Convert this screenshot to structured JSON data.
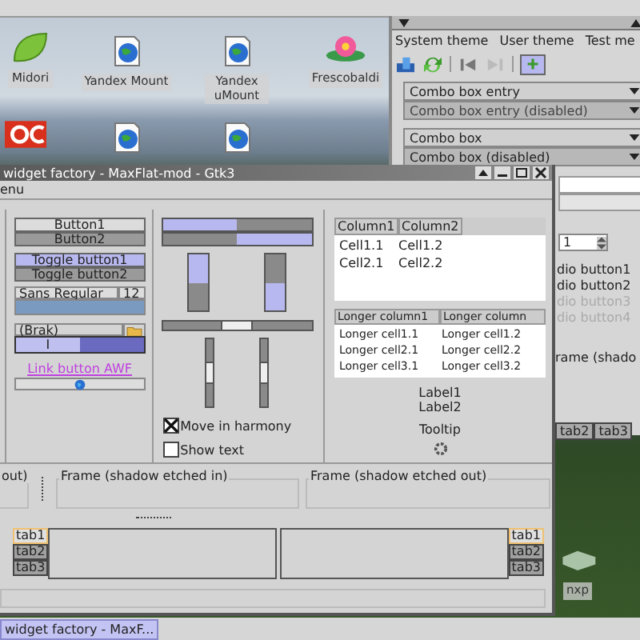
{
  "desktop_icons": [
    {
      "label": "Midori",
      "kind": "leaf"
    },
    {
      "label": "Yandex Mount",
      "kind": "globe"
    },
    {
      "label": "Yandex uMount",
      "kind": "globe"
    },
    {
      "label": "Frescobaldi",
      "kind": "flower"
    },
    {
      "kind": "office"
    },
    {
      "kind": "globe"
    },
    {
      "kind": "globe"
    },
    {
      "label": "nxp",
      "kind": "glass"
    }
  ],
  "back_window": {
    "menu": [
      "System theme",
      "User theme",
      "Test me"
    ],
    "combos": [
      {
        "text": "Combo box entry",
        "kind": "entry",
        "disabled": false
      },
      {
        "text": "Combo box entry (disabled)",
        "kind": "entry",
        "disabled": true
      },
      {
        "text": "Combo box",
        "kind": "combo",
        "disabled": false
      },
      {
        "text": "Combo box (disabled)",
        "kind": "combo",
        "disabled": true
      }
    ],
    "spin_value": "1",
    "radio_buttons": [
      {
        "label": "dio button1",
        "disabled": false
      },
      {
        "label": "dio button2",
        "disabled": false
      },
      {
        "label": "dio button3",
        "disabled": true
      },
      {
        "label": "dio button4",
        "disabled": true
      }
    ],
    "frame_label": "rame (shado",
    "tabs": [
      {
        "label": "tab2",
        "selected": false
      },
      {
        "label": "tab3",
        "selected": false
      }
    ]
  },
  "front_window": {
    "title": "widget factory - MaxFlat-mod - Gtk3",
    "menu": [
      "enu"
    ],
    "buttons": [
      {
        "label": "Button1",
        "pressed": false
      },
      {
        "label": "Button2",
        "pressed": true
      }
    ],
    "toggle_buttons": [
      {
        "label": "Toggle button1",
        "selected": true
      },
      {
        "label": "Toggle button2",
        "selected": false
      }
    ],
    "font_button": {
      "font": "Sans Regular",
      "size": "12"
    },
    "file_chooser": "(Brak)",
    "switch": {
      "label": "I",
      "on": true
    },
    "link_button": "Link button AWF",
    "progress_bars": [
      {
        "kind": "horizontal",
        "inverted": false,
        "level": 0.5
      },
      {
        "kind": "horizontal",
        "inverted": true,
        "level": 0.5
      },
      {
        "kind": "vertical",
        "inverted": false,
        "level": 0.5
      },
      {
        "kind": "vertical",
        "inverted": true,
        "level": 0.5
      }
    ],
    "scales": [
      {
        "kind": "horizontal",
        "level": 0.5
      },
      {
        "kind": "vertical",
        "level": 0.5
      },
      {
        "kind": "vertical",
        "level": 0.5
      }
    ],
    "checkboxes": [
      {
        "label": "Move in harmony",
        "checked": true
      },
      {
        "label": "Show text",
        "checked": false
      }
    ],
    "tree1": {
      "columns": [
        "Column1",
        "Column2"
      ],
      "rows": [
        [
          "Cell1.1",
          "Cell1.2"
        ],
        [
          "Cell2.1",
          "Cell2.2"
        ]
      ]
    },
    "tree2": {
      "columns": [
        "Longer column1",
        "Longer column"
      ],
      "rows": [
        [
          "Longer cell1.1",
          "Longer cell1.2"
        ],
        [
          "Longer cell2.1",
          "Longer cell2.2"
        ],
        [
          "Longer cell3.1",
          "Longer cell3.2"
        ]
      ]
    },
    "labels": [
      "Label1",
      "Label2"
    ],
    "tooltip": "Tooltip",
    "frames": [
      "out)",
      "Frame (shadow etched in)",
      "Frame (shadow etched out)"
    ],
    "notebooks": [
      {
        "kind": "left",
        "tabs": [
          {
            "label": "tab1",
            "selected": true
          },
          {
            "label": "tab2",
            "selected": false
          },
          {
            "label": "tab3",
            "selected": false
          }
        ]
      },
      {
        "kind": "right",
        "tabs": [
          {
            "label": "tab1",
            "selected": true
          },
          {
            "label": "tab2",
            "selected": false
          },
          {
            "label": "tab3",
            "selected": false
          }
        ]
      }
    ]
  },
  "taskbar": {
    "tasks": [
      {
        "label": "widget factory - MaxF...",
        "selected": true
      }
    ]
  }
}
